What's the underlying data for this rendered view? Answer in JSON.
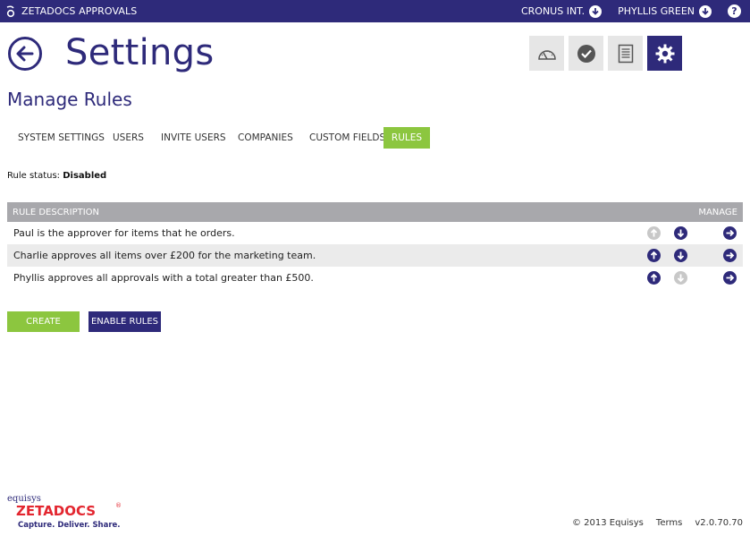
{
  "topbar": {
    "app_name": "ZETADOCS APPROVALS",
    "company": "CRONUS INT.",
    "user": "PHYLLIS GREEN",
    "help": "?"
  },
  "header": {
    "title": "Settings",
    "tiles": [
      {
        "icon": "dashboard-gauge-icon",
        "active": false
      },
      {
        "icon": "approve-check-icon",
        "active": false
      },
      {
        "icon": "document-list-icon",
        "active": false
      },
      {
        "icon": "settings-gear-icon",
        "active": true
      }
    ]
  },
  "section_title": "Manage Rules",
  "tabs": [
    {
      "label": "SYSTEM SETTINGS",
      "active": false
    },
    {
      "label": "USERS",
      "active": false
    },
    {
      "label": "INVITE USERS",
      "active": false
    },
    {
      "label": "COMPANIES",
      "active": false
    },
    {
      "label": "CUSTOM FIELDS",
      "active": false
    },
    {
      "label": "RULES",
      "active": true
    }
  ],
  "rule_status": {
    "label": "Rule status:",
    "value": "Disabled"
  },
  "table": {
    "headers": {
      "description": "RULE DESCRIPTION",
      "manage": "MANAGE"
    },
    "rows": [
      {
        "description": "Paul is the approver for items that he orders.",
        "up_enabled": false,
        "down_enabled": true
      },
      {
        "description": "Charlie approves all items over £200 for the marketing team.",
        "up_enabled": true,
        "down_enabled": true
      },
      {
        "description": "Phyllis approves all approvals with a total greater than £500.",
        "up_enabled": true,
        "down_enabled": false
      }
    ]
  },
  "buttons": {
    "create": "CREATE",
    "enable": "ENABLE RULES"
  },
  "logo": {
    "brand": "equisys",
    "product": "ZETADOCS",
    "tagline": "Capture. Deliver. Share.",
    "registered": "®"
  },
  "footer": {
    "copyright": "© 2013 Equisys",
    "terms": "Terms",
    "version": "v2.0.70.70"
  },
  "colors": {
    "brand_blue": "#2e2a7a",
    "accent_green": "#8cc63f",
    "header_gray": "#a8a8ac",
    "disabled_gray": "#c8c8c8",
    "logo_red": "#e3262f"
  }
}
